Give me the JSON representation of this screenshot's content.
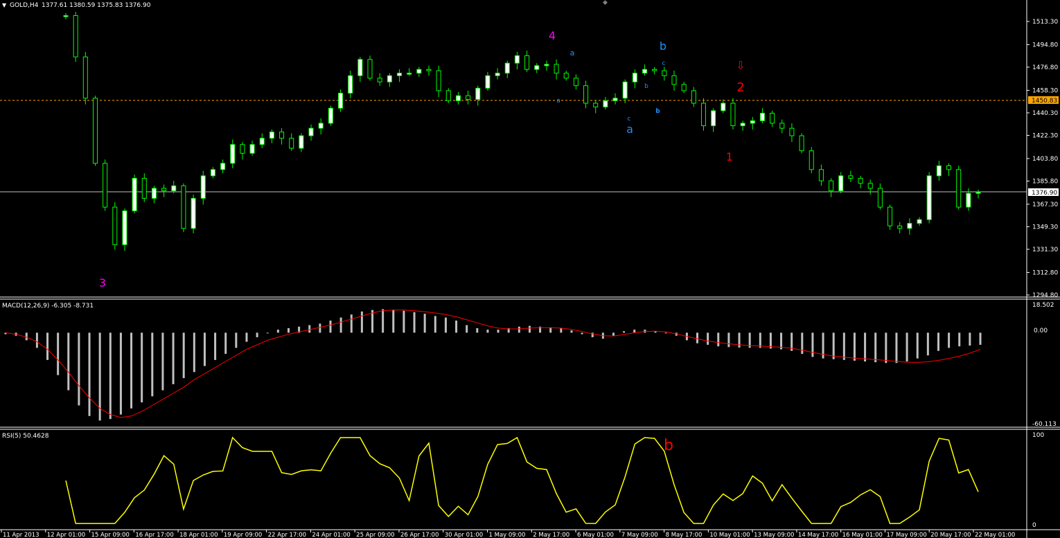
{
  "header": {
    "symbol_label": "GOLD,H4",
    "ohlc_label": "1377.61 1380.59 1375.83 1376.90"
  },
  "colors": {
    "background": "#000000",
    "bull_candle": "#ffffff",
    "candle_outline": "#00ff00",
    "grid_separator": "#ffffff",
    "axis_text": "#ffffff",
    "price_line": "#c0c0c0",
    "dotted_level": "#ffa500",
    "macd_hist": "#c0c0c0",
    "macd_signal": "#ff0000",
    "rsi_line": "#ffff00",
    "wave_magenta": "#ff00ff",
    "wave_blue": "#1e90ff",
    "wave_red": "#ff0000"
  },
  "price_axis": {
    "ticks": [
      "1513.30",
      "1494.80",
      "1476.80",
      "1458.30",
      "1440.30",
      "1422.30",
      "1403.80",
      "1385.80",
      "1367.30",
      "1349.30",
      "1331.30",
      "1312.80",
      "1294.80"
    ],
    "current_price_tag": "1376.90",
    "level_tag": "1450.83"
  },
  "macd_panel": {
    "label": "MACD(12,26,9) -6.305 -8.731",
    "ticks": [
      "18.502",
      "0.00",
      "-60.113"
    ]
  },
  "rsi_panel": {
    "label": "RSI(5) 50.4628",
    "ticks": [
      "100",
      "0"
    ]
  },
  "time_axis": {
    "labels": [
      "11 Apr 2013",
      "12 Apr 01:00",
      "15 Apr 09:00",
      "16 Apr 17:00",
      "18 Apr 01:00",
      "19 Apr 09:00",
      "22 Apr 17:00",
      "24 Apr 01:00",
      "25 Apr 09:00",
      "26 Apr 17:00",
      "30 Apr 01:00",
      "1 May 09:00",
      "2 May 17:00",
      "6 May 01:00",
      "7 May 09:00",
      "8 May 17:00",
      "10 May 01:00",
      "13 May 09:00",
      "14 May 17:00",
      "16 May 01:00",
      "17 May 09:00",
      "20 May 17:00",
      "22 May 01:00"
    ]
  },
  "wave_labels": [
    {
      "text": "3",
      "color": "magenta"
    },
    {
      "text": "4",
      "color": "magenta"
    },
    {
      "text": "a",
      "color": "blue"
    },
    {
      "text": "b",
      "color": "blue"
    },
    {
      "text": "a",
      "color": "blue"
    },
    {
      "text": "b",
      "color": "blue"
    },
    {
      "text": "c",
      "color": "blue"
    },
    {
      "text": "a",
      "color": "blue"
    },
    {
      "text": "b",
      "color": "blue"
    },
    {
      "text": "c",
      "color": "blue"
    },
    {
      "text": "b",
      "color": "blue"
    },
    {
      "text": "1",
      "color": "red"
    },
    {
      "text": "2",
      "color": "red"
    },
    {
      "text": "⇩",
      "color": "red"
    },
    {
      "text": "b",
      "color": "red"
    }
  ],
  "chart_data": {
    "type": "candlestick",
    "title": "GOLD,H4",
    "ylim": [
      1294.8,
      1518
    ],
    "closes": [
      1530,
      1485,
      1452,
      1400,
      1365,
      1335,
      1362,
      1388,
      1372,
      1380,
      1378,
      1382,
      1348,
      1372,
      1390,
      1395,
      1400,
      1415,
      1408,
      1415,
      1420,
      1425,
      1420,
      1412,
      1422,
      1428,
      1432,
      1444,
      1456,
      1470,
      1483,
      1468,
      1465,
      1470,
      1472,
      1472,
      1475,
      1474,
      1458,
      1450,
      1454,
      1451,
      1460,
      1470,
      1472,
      1480,
      1486,
      1475,
      1478,
      1479,
      1472,
      1468,
      1462,
      1448,
      1445,
      1450,
      1452,
      1465,
      1472,
      1475,
      1474,
      1470,
      1463,
      1458,
      1448,
      1430,
      1442,
      1448,
      1430,
      1432,
      1434,
      1440,
      1432,
      1428,
      1422,
      1410,
      1395,
      1386,
      1378,
      1390,
      1388,
      1384,
      1380,
      1365,
      1350,
      1348,
      1352,
      1355,
      1390,
      1398,
      1395,
      1365,
      1376,
      1376.9
    ],
    "macd_hist": [
      -1,
      -2,
      -5,
      -10,
      -18,
      -28,
      -38,
      -48,
      -55,
      -58,
      -57,
      -54,
      -50,
      -46,
      -42,
      -38,
      -34,
      -30,
      -26,
      -22,
      -18,
      -14,
      -10,
      -6,
      -3,
      0,
      2,
      3,
      4,
      5,
      6,
      8,
      10,
      12,
      14,
      15,
      15.5,
      15.2,
      14.5,
      13.5,
      12.5,
      11,
      10,
      8,
      5,
      3,
      2,
      2,
      3,
      4,
      4.5,
      4,
      3.5,
      3,
      1.5,
      -1,
      -3,
      -4,
      -2,
      1,
      2,
      2,
      1,
      0,
      -2,
      -5,
      -7,
      -8,
      -9,
      -9.5,
      -9.8,
      -10,
      -10,
      -10.5,
      -11,
      -12,
      -14,
      -16,
      -17,
      -17.5,
      -18,
      -18.5,
      -19,
      -19.5,
      -20,
      -20,
      -19,
      -17,
      -15,
      -12,
      -10,
      -9,
      -8.5,
      -8
    ],
    "macd_signal": [
      0,
      -1,
      -3,
      -6,
      -11,
      -18,
      -26,
      -35,
      -43,
      -50,
      -54,
      -56,
      -55,
      -52,
      -48,
      -44,
      -40,
      -36,
      -31,
      -27,
      -23,
      -19,
      -15,
      -11,
      -8,
      -5,
      -3,
      -1,
      0.5,
      2,
      3.5,
      5,
      7,
      9,
      11,
      13,
      14.5,
      15,
      15,
      14.5,
      13.8,
      13,
      12,
      10.5,
      8.5,
      6.5,
      4.5,
      3,
      2.5,
      2.5,
      3,
      3.3,
      3.3,
      3,
      2.2,
      0.8,
      -0.8,
      -2,
      -2.2,
      -1.2,
      0,
      0.8,
      1,
      0.5,
      -0.8,
      -2.5,
      -4,
      -5.5,
      -6.5,
      -7.3,
      -8,
      -8.5,
      -8.8,
      -9.2,
      -9.6,
      -10.3,
      -11.5,
      -13,
      -14.3,
      -15.5,
      -16.2,
      -16.8,
      -17.3,
      -17.8,
      -18.3,
      -19,
      -19.5,
      -19.6,
      -19.2,
      -18.3,
      -17,
      -15.5,
      -13.5,
      -11
    ]
  }
}
